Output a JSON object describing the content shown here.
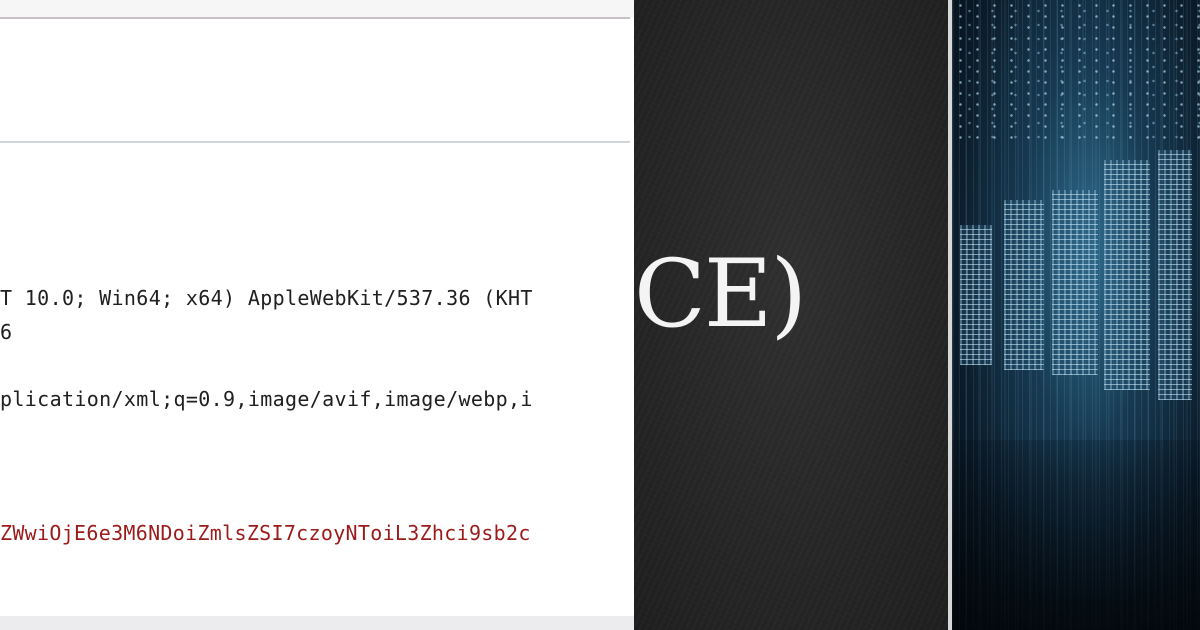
{
  "request_view": {
    "lines": [
      "T 10.0; Win64; x64) AppleWebKit/537.36 (KHT",
      "6",
      "plication/xml;q=0.9,image/avif,image/webp,i",
      "ZWwiOjE6e3M6NDoiZmlsZSI7czoyNToiL3Zhci9sb2c"
    ],
    "text_color": "#202020",
    "highlight_color": "#9b1b1b"
  },
  "slide": {
    "title_fragment": "CE)",
    "background": "#262626",
    "text_color": "#f4f4f4"
  },
  "photo": {
    "subject": "server-room-image",
    "tint": "#173a52"
  }
}
